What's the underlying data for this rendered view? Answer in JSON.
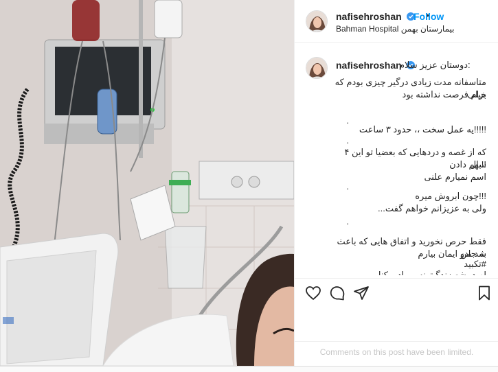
{
  "post": {
    "username": "nafisehroshan",
    "follow_label": "Follow",
    "dot": "•",
    "location": "Bahman Hospital بیمارستان بهمن"
  },
  "caption": {
    "username": "nafisehroshan",
    "greeting": "دوستان عزیز سلام:",
    "line1": "متاسفانه مدت زیادی درگیر چیزی بودم که خیلی",
    "line2": "برام فرصت نداشته بود",
    "dot1": ".",
    "line3": "!!!!!یه عمل سخت ،، حدود ۳ ساعت",
    "dot2": ".",
    "line4": "که از غصه و دردهایی که بعضیا تو این ۴ سال",
    "line5": "!!بهم دادن",
    "line6": "اسم نمیارم علنی",
    "dot3": ".",
    "line7": "!!!چون ابروش میره",
    "line8": "ولی به عزیزانم خواهم گفت...",
    "dot4": ".",
    "line9": "فقط حرص نخورید و اتفاق هایی که باعث شد من",
    "line10": "به جادو ایمان بیارم",
    "line11": "#تکبید",
    "line12": "امید بشه زندگیتونه و بیاد و کنار"
  },
  "actions": {
    "like_icon": "heart-icon",
    "comment_icon": "comment-icon",
    "share_icon": "paper-plane-icon",
    "save_icon": "bookmark-icon"
  },
  "comments_limited_text": "Comments on this post have been limited.",
  "colors": {
    "accent": "#0095f6",
    "text": "#262626",
    "muted": "#c7c7c7",
    "border": "#efefef"
  }
}
